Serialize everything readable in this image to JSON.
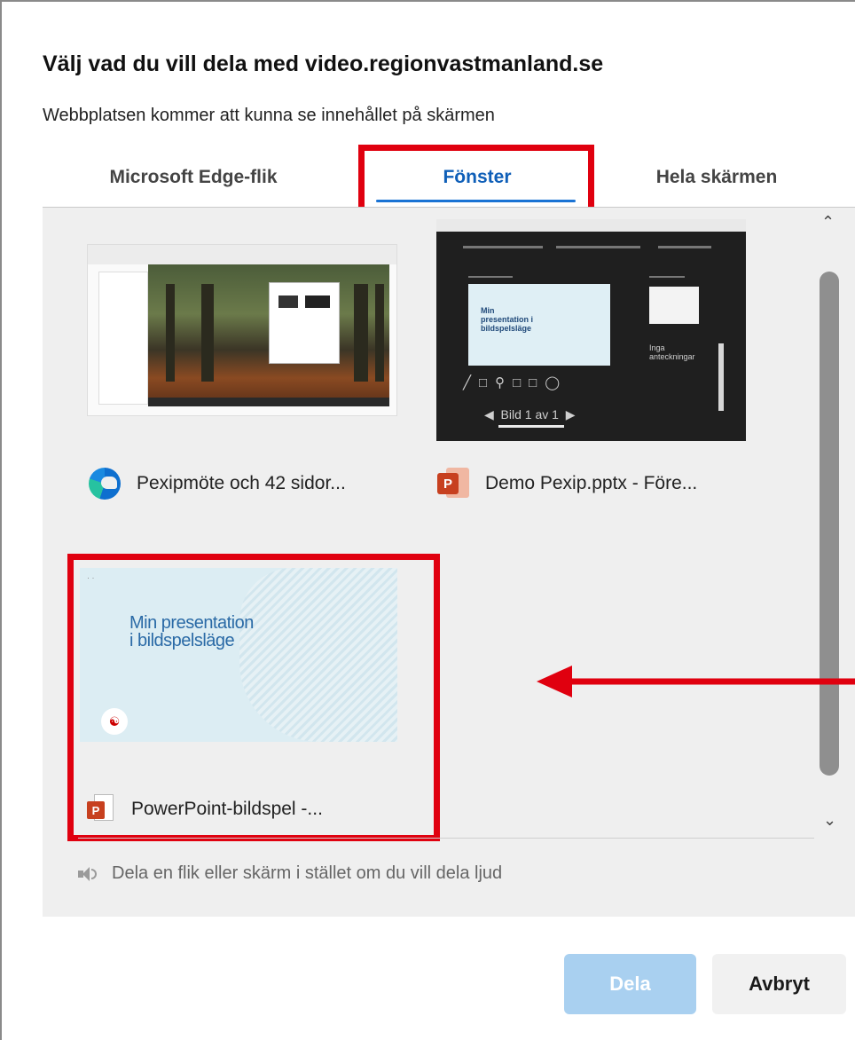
{
  "dialog": {
    "title": "Välj vad du vill dela med video.regionvastmanland.se",
    "subtitle": "Webbplatsen kommer att kunna se innehållet på skärmen"
  },
  "tabs": [
    {
      "label": "Microsoft Edge-flik",
      "selected": false
    },
    {
      "label": "Fönster",
      "selected": true
    },
    {
      "label": "Hela skärmen",
      "selected": false
    }
  ],
  "windows": [
    {
      "label": "Pexipmöte och 42 sidor...",
      "icon": "edge-browser-icon"
    },
    {
      "label": "Demo Pexip.pptx - Före...",
      "icon": "powerpoint-icon"
    },
    {
      "label": "PowerPoint-bildspel  -...",
      "icon": "powerpoint-icon"
    }
  ],
  "thumbnails": {
    "presenter_slide_text": "Min presentation i bildspelsläge",
    "slide_title_line1": "Min presentation",
    "slide_title_line2": "i bildspelsläge",
    "notes_text": "Inga anteckningar",
    "slide_counter": "Bild 1 av 1"
  },
  "audio_note": "Dela en flik eller skärm i stället om du vill dela ljud",
  "buttons": {
    "share": "Dela",
    "cancel": "Avbryt",
    "share_enabled": false
  },
  "colors": {
    "accent": "#1a73d4",
    "highlight": "#e0000f",
    "share_disabled": "#a9d0f0"
  }
}
